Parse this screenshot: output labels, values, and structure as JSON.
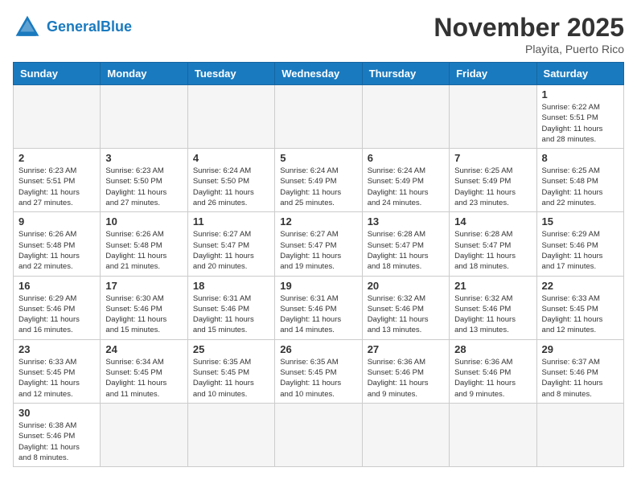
{
  "header": {
    "logo_general": "General",
    "logo_blue": "Blue",
    "month_title": "November 2025",
    "location": "Playita, Puerto Rico"
  },
  "weekdays": [
    "Sunday",
    "Monday",
    "Tuesday",
    "Wednesday",
    "Thursday",
    "Friday",
    "Saturday"
  ],
  "days": [
    {
      "num": "",
      "info": ""
    },
    {
      "num": "",
      "info": ""
    },
    {
      "num": "",
      "info": ""
    },
    {
      "num": "",
      "info": ""
    },
    {
      "num": "",
      "info": ""
    },
    {
      "num": "",
      "info": ""
    },
    {
      "num": "1",
      "info": "Sunrise: 6:22 AM\nSunset: 5:51 PM\nDaylight: 11 hours\nand 28 minutes."
    },
    {
      "num": "2",
      "info": "Sunrise: 6:23 AM\nSunset: 5:51 PM\nDaylight: 11 hours\nand 27 minutes."
    },
    {
      "num": "3",
      "info": "Sunrise: 6:23 AM\nSunset: 5:50 PM\nDaylight: 11 hours\nand 27 minutes."
    },
    {
      "num": "4",
      "info": "Sunrise: 6:24 AM\nSunset: 5:50 PM\nDaylight: 11 hours\nand 26 minutes."
    },
    {
      "num": "5",
      "info": "Sunrise: 6:24 AM\nSunset: 5:49 PM\nDaylight: 11 hours\nand 25 minutes."
    },
    {
      "num": "6",
      "info": "Sunrise: 6:24 AM\nSunset: 5:49 PM\nDaylight: 11 hours\nand 24 minutes."
    },
    {
      "num": "7",
      "info": "Sunrise: 6:25 AM\nSunset: 5:49 PM\nDaylight: 11 hours\nand 23 minutes."
    },
    {
      "num": "8",
      "info": "Sunrise: 6:25 AM\nSunset: 5:48 PM\nDaylight: 11 hours\nand 22 minutes."
    },
    {
      "num": "9",
      "info": "Sunrise: 6:26 AM\nSunset: 5:48 PM\nDaylight: 11 hours\nand 22 minutes."
    },
    {
      "num": "10",
      "info": "Sunrise: 6:26 AM\nSunset: 5:48 PM\nDaylight: 11 hours\nand 21 minutes."
    },
    {
      "num": "11",
      "info": "Sunrise: 6:27 AM\nSunset: 5:47 PM\nDaylight: 11 hours\nand 20 minutes."
    },
    {
      "num": "12",
      "info": "Sunrise: 6:27 AM\nSunset: 5:47 PM\nDaylight: 11 hours\nand 19 minutes."
    },
    {
      "num": "13",
      "info": "Sunrise: 6:28 AM\nSunset: 5:47 PM\nDaylight: 11 hours\nand 18 minutes."
    },
    {
      "num": "14",
      "info": "Sunrise: 6:28 AM\nSunset: 5:47 PM\nDaylight: 11 hours\nand 18 minutes."
    },
    {
      "num": "15",
      "info": "Sunrise: 6:29 AM\nSunset: 5:46 PM\nDaylight: 11 hours\nand 17 minutes."
    },
    {
      "num": "16",
      "info": "Sunrise: 6:29 AM\nSunset: 5:46 PM\nDaylight: 11 hours\nand 16 minutes."
    },
    {
      "num": "17",
      "info": "Sunrise: 6:30 AM\nSunset: 5:46 PM\nDaylight: 11 hours\nand 15 minutes."
    },
    {
      "num": "18",
      "info": "Sunrise: 6:31 AM\nSunset: 5:46 PM\nDaylight: 11 hours\nand 15 minutes."
    },
    {
      "num": "19",
      "info": "Sunrise: 6:31 AM\nSunset: 5:46 PM\nDaylight: 11 hours\nand 14 minutes."
    },
    {
      "num": "20",
      "info": "Sunrise: 6:32 AM\nSunset: 5:46 PM\nDaylight: 11 hours\nand 13 minutes."
    },
    {
      "num": "21",
      "info": "Sunrise: 6:32 AM\nSunset: 5:46 PM\nDaylight: 11 hours\nand 13 minutes."
    },
    {
      "num": "22",
      "info": "Sunrise: 6:33 AM\nSunset: 5:45 PM\nDaylight: 11 hours\nand 12 minutes."
    },
    {
      "num": "23",
      "info": "Sunrise: 6:33 AM\nSunset: 5:45 PM\nDaylight: 11 hours\nand 12 minutes."
    },
    {
      "num": "24",
      "info": "Sunrise: 6:34 AM\nSunset: 5:45 PM\nDaylight: 11 hours\nand 11 minutes."
    },
    {
      "num": "25",
      "info": "Sunrise: 6:35 AM\nSunset: 5:45 PM\nDaylight: 11 hours\nand 10 minutes."
    },
    {
      "num": "26",
      "info": "Sunrise: 6:35 AM\nSunset: 5:45 PM\nDaylight: 11 hours\nand 10 minutes."
    },
    {
      "num": "27",
      "info": "Sunrise: 6:36 AM\nSunset: 5:46 PM\nDaylight: 11 hours\nand 9 minutes."
    },
    {
      "num": "28",
      "info": "Sunrise: 6:36 AM\nSunset: 5:46 PM\nDaylight: 11 hours\nand 9 minutes."
    },
    {
      "num": "29",
      "info": "Sunrise: 6:37 AM\nSunset: 5:46 PM\nDaylight: 11 hours\nand 8 minutes."
    },
    {
      "num": "30",
      "info": "Sunrise: 6:38 AM\nSunset: 5:46 PM\nDaylight: 11 hours\nand 8 minutes."
    },
    {
      "num": "",
      "info": ""
    },
    {
      "num": "",
      "info": ""
    },
    {
      "num": "",
      "info": ""
    },
    {
      "num": "",
      "info": ""
    },
    {
      "num": "",
      "info": ""
    },
    {
      "num": "",
      "info": ""
    }
  ]
}
